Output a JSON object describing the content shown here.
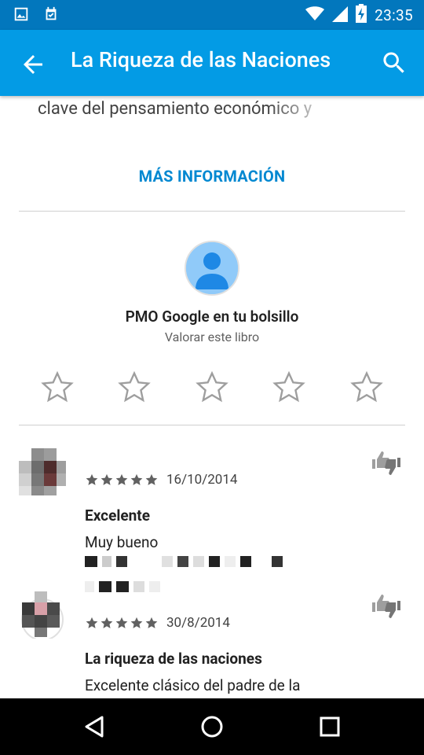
{
  "status_bar": {
    "time": "23:35",
    "icons": [
      "image-icon",
      "calendar-check-icon",
      "wifi-icon",
      "signal-icon",
      "battery-charging-icon"
    ]
  },
  "app_bar": {
    "title": "La Riqueza de las Naciones",
    "back_icon": "arrow-back-icon",
    "search_icon": "search-icon"
  },
  "description": {
    "text": "clave del pensamiento económico y"
  },
  "more_info": {
    "label": "MÁS INFORMACIÓN"
  },
  "my_rating": {
    "user_name": "PMO Google en tu bolsillo",
    "prompt": "Valorar este libro",
    "stars_total": 5,
    "stars_selected": 0
  },
  "reviews": [
    {
      "date": "16/10/2014",
      "rating": 5,
      "title": "Excelente",
      "body": "Muy bueno"
    },
    {
      "date": "30/8/2014",
      "rating": 5,
      "title": "La riqueza de las naciones",
      "body": "Excelente clásico del padre de la"
    }
  ],
  "nav_bar": {
    "back": "nav-back-icon",
    "home": "nav-home-icon",
    "recents": "nav-recents-icon"
  },
  "colors": {
    "status_bar": "#0277bd",
    "app_bar": "#039be5",
    "accent": "#0288d1",
    "star_outline": "#9e9e9e",
    "star_filled": "#616161"
  }
}
